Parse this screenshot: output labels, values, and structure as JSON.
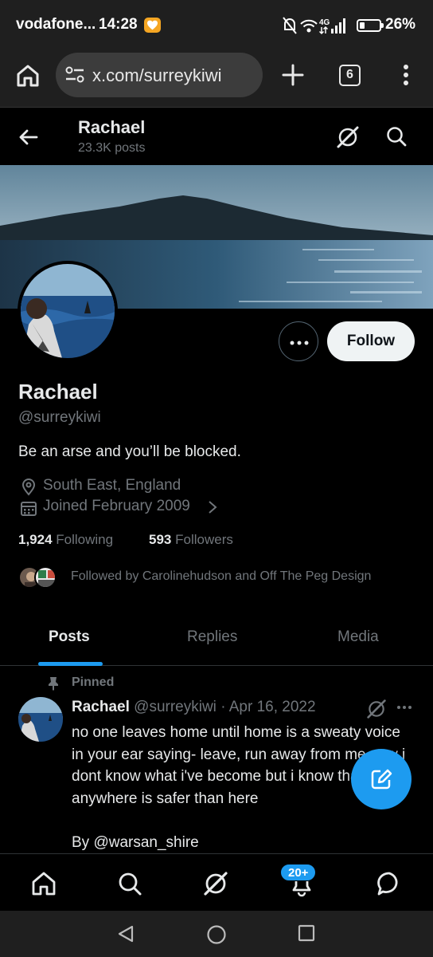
{
  "status_bar": {
    "carrier": "vodafone...",
    "time": "14:28",
    "network": "4G",
    "battery_pct": "26%",
    "battery_level": 0.26
  },
  "browser": {
    "url": "x.com/surreykiwi",
    "tab_count": "6"
  },
  "header": {
    "name": "Rachael",
    "post_count": "23.3K posts"
  },
  "profile": {
    "name": "Rachael",
    "handle": "@surreykiwi",
    "bio": "Be an arse and you’ll be blocked.",
    "location": "South East, England",
    "joined": "Joined February 2009",
    "following_count": "1,924",
    "following_label": "Following",
    "followers_count": "593",
    "followers_label": "Followers",
    "followed_by": "Followed by Carolinehudson and Off The Peg Design",
    "follow_label": "Follow"
  },
  "tabs": [
    {
      "label": "Posts"
    },
    {
      "label": "Replies"
    },
    {
      "label": "Media"
    }
  ],
  "pinned_post": {
    "pinned_label": "Pinned",
    "author": "Rachael",
    "handle": "@surreykiwi",
    "sep": "·",
    "date": "Apr 16, 2022",
    "text": "no one leaves home until home is a sweaty voice in your ear saying- leave, run away from me now i dont know what i've become but i know that anywhere is safer than here\n\nBy @warsan_shire"
  },
  "bottom_nav": {
    "notification_badge": "20+"
  },
  "colors": {
    "accent": "#1d9bf0",
    "background": "#000000",
    "muted_text": "#71767b",
    "primary_text": "#e7e9ea"
  }
}
